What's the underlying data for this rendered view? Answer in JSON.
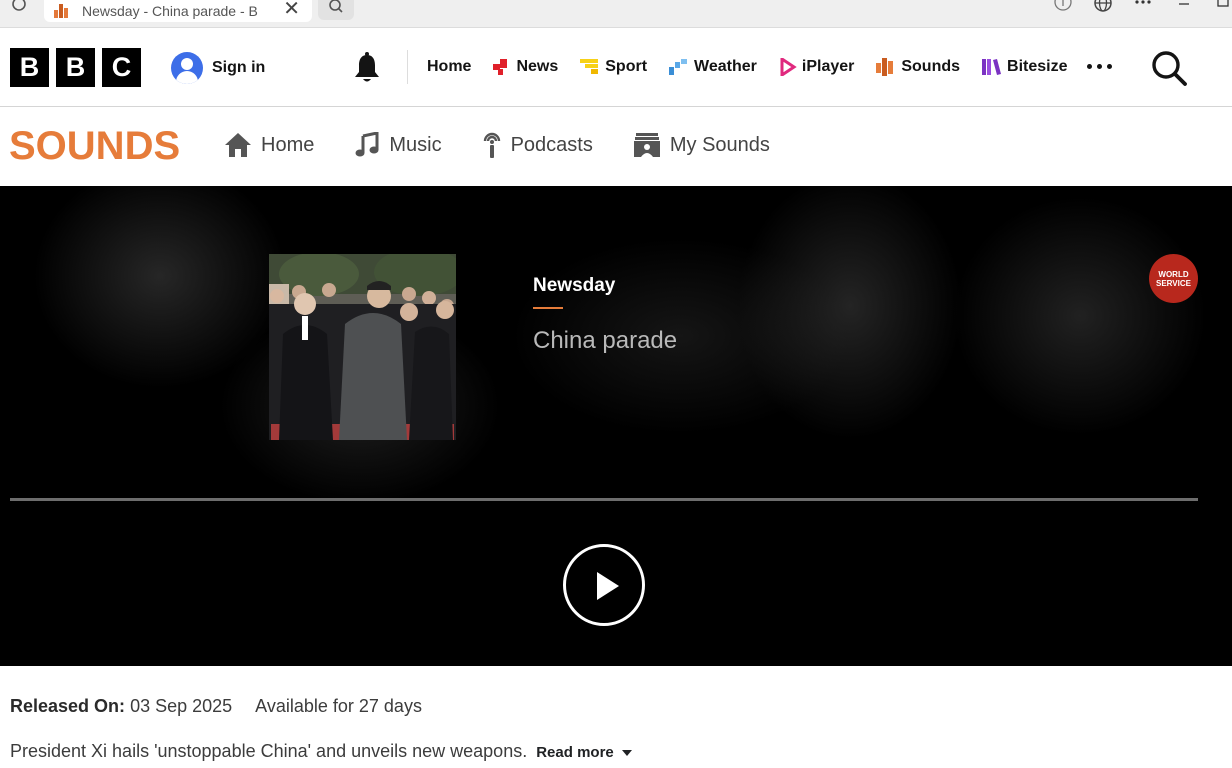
{
  "browser": {
    "tab_title": "Newsday - China parade - B",
    "tab_close": "✕"
  },
  "bbc_nav": {
    "logo": [
      "B",
      "B",
      "C"
    ],
    "sign_in": "Sign in",
    "items": [
      {
        "label": "Home",
        "color": ""
      },
      {
        "label": "News",
        "color": "#e0202a"
      },
      {
        "label": "Sport",
        "color": "#f7d117"
      },
      {
        "label": "Weather",
        "color": "#3a8ed6"
      },
      {
        "label": "iPlayer",
        "color": "#e0297e"
      },
      {
        "label": "Sounds",
        "color": "#e67c3a"
      },
      {
        "label": "Bitesize",
        "color": "#7b33c2"
      }
    ]
  },
  "sounds_nav": {
    "logo": "SOUNDS",
    "logo_color": "#e67c3a",
    "items": [
      {
        "label": "Home",
        "icon": "home-icon"
      },
      {
        "label": "Music",
        "icon": "music-note-icon"
      },
      {
        "label": "Podcasts",
        "icon": "podcast-icon"
      },
      {
        "label": "My Sounds",
        "icon": "my-sounds-icon"
      }
    ]
  },
  "episode": {
    "brand": "Newsday",
    "title": "China parade",
    "badge_line1": "WORLD",
    "badge_line2": "SERVICE",
    "progress": 0
  },
  "details": {
    "released_label": "Released On:",
    "released_date": "03 Sep 2025",
    "availability": "Available for 27 days",
    "summary": "President Xi hails 'unstoppable China' and unveils new weapons.",
    "read_more": "Read more"
  }
}
